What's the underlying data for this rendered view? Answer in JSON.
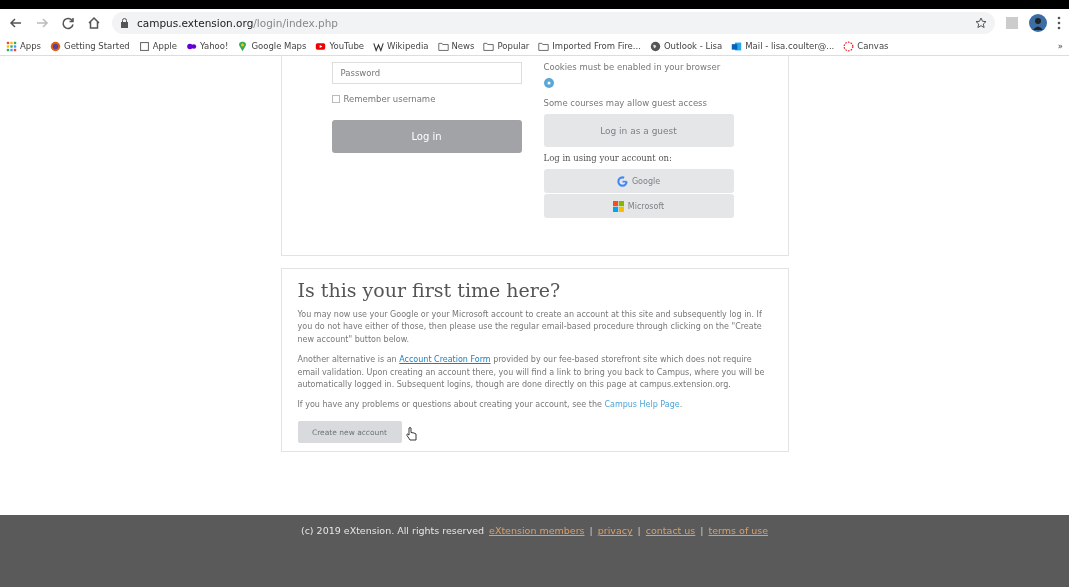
{
  "browser": {
    "url_host": "campus.extension.org",
    "url_path": "/login/index.php",
    "bookmarks": [
      {
        "label": "Apps",
        "kind": "apps"
      },
      {
        "label": "Getting Started",
        "kind": "firefox"
      },
      {
        "label": "Apple",
        "kind": "page"
      },
      {
        "label": "Yahoo!",
        "kind": "yahoo"
      },
      {
        "label": "Google Maps",
        "kind": "maps"
      },
      {
        "label": "YouTube",
        "kind": "youtube"
      },
      {
        "label": "Wikipedia",
        "kind": "wiki"
      },
      {
        "label": "News",
        "kind": "folder"
      },
      {
        "label": "Popular",
        "kind": "folder"
      },
      {
        "label": "Imported From Fire...",
        "kind": "folder"
      },
      {
        "label": "Outlook - Lisa",
        "kind": "globe"
      },
      {
        "label": "Mail - lisa.coulter@...",
        "kind": "outlook"
      },
      {
        "label": "Canvas",
        "kind": "canvas"
      }
    ],
    "overflow": "»"
  },
  "login": {
    "password_placeholder": "Password",
    "remember_label": "Remember username",
    "remember_checked": false,
    "login_button": "Log in",
    "cookies_note": "Cookies must be enabled in your browser",
    "guest_note": "Some courses may allow guest access",
    "guest_button": "Log in as a guest",
    "oauth_heading": "Log in using your account on:",
    "providers": [
      {
        "label": "Google",
        "kind": "google"
      },
      {
        "label": "Microsoft",
        "kind": "microsoft"
      }
    ]
  },
  "first_time": {
    "heading": "Is this your first time here?",
    "paragraph_1": "You may now use your Google or your Microsoft account to create an account at this site and subsequently log in. If you do not have either of those, then please use the regular email-based procedure through clicking on the \"Create new account\" button below.",
    "paragraph_2_before": "Another alternative is an ",
    "paragraph_2_link": "Account Creation Form",
    "paragraph_2_after": " provided by our fee-based storefront site which does not require email validation. Upon creating an account there, you will find a link to bring you back to Campus, where you will be automatically logged in. Subsequent logins, though are done directly on this page at campus.extension.org.",
    "paragraph_3_before": "If you have any problems or questions about creating your account, see the ",
    "paragraph_3_link": "Campus Help Page",
    "paragraph_3_after": ".",
    "create_button": "Create new account"
  },
  "footer": {
    "copyright": "(c) 2019 eXtension. All rights reserved",
    "links": [
      "eXtension members",
      "privacy",
      "contact us",
      "terms of use"
    ],
    "separator": "|"
  }
}
